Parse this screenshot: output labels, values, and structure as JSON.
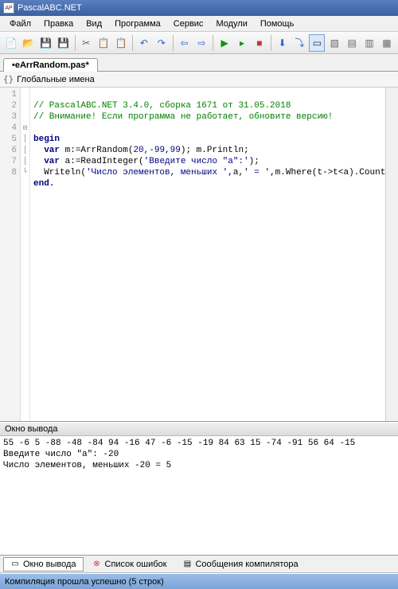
{
  "window": {
    "title": "PascalABC.NET"
  },
  "menu": {
    "file": "Файл",
    "edit": "Правка",
    "view": "Вид",
    "program": "Программа",
    "service": "Сервис",
    "modules": "Модули",
    "help": "Помощь"
  },
  "tab": {
    "filename": "•eArrRandom.pas*"
  },
  "nav": {
    "scope": "Глобальные имена"
  },
  "code": {
    "lines": [
      "1",
      "2",
      "3",
      "4",
      "5",
      "6",
      "7",
      "8"
    ],
    "l1_comment": "// PascalABC.NET 3.4.0, сборка 1671 от 31.05.2018",
    "l2_comment": "// Внимание! Если программа не работает, обновите версию!",
    "l4_begin": "begin",
    "l5_pre": "  ",
    "l5_kw_var": "var",
    "l5_mid": " m:=ArrRandom(",
    "l5_args": "20,-99,99",
    "l5_post": "); m.Println;",
    "l6_pre": "  ",
    "l6_kw_var": "var",
    "l6_mid": " a:=ReadInteger(",
    "l6_str": "'Введите число \"a\":'",
    "l6_post": ");",
    "l7_pre": "  Writeln(",
    "l7_str1": "'Число элементов, меньших '",
    "l7_mid1": ",a,",
    "l7_str2": "' = '",
    "l7_mid2": ",m.Where(t->t<a).Count)",
    "l8_end": "end."
  },
  "output": {
    "title": "Окно вывода",
    "line1": "55 -6 5 -88 -48 -84 94 -16 47 -6 -15 -19 84 63 15 -74 -91 56 64 -15",
    "line2": "Введите число \"a\": -20",
    "line3": "Число элементов, меньших -20 = 5"
  },
  "bottom_tabs": {
    "output": "Окно вывода",
    "errors": "Список ошибок",
    "compiler": "Сообщения компилятора"
  },
  "status": {
    "text": "Компиляция прошла успешно (5 строк)"
  }
}
